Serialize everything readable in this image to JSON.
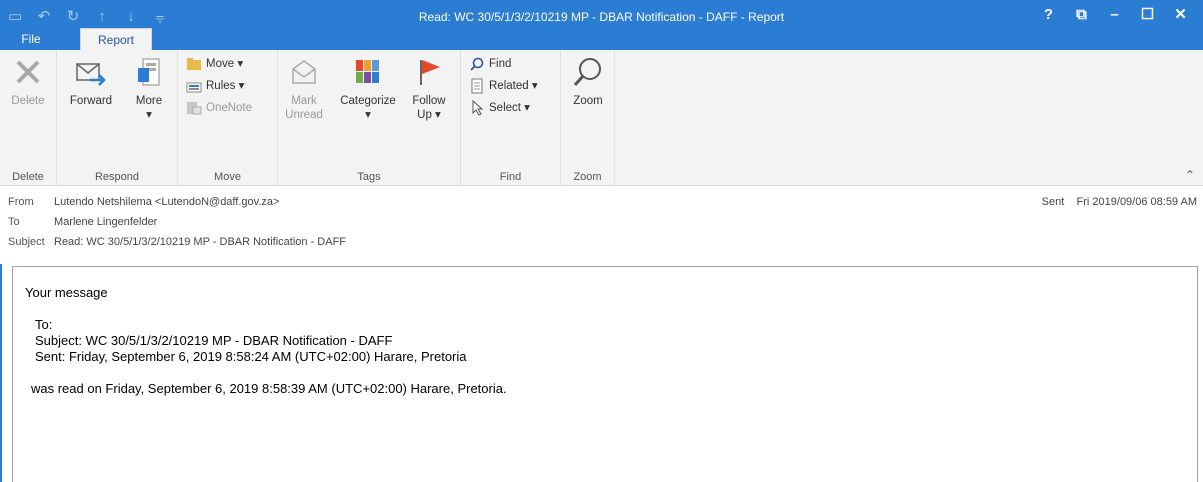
{
  "window": {
    "title": "Read: WC 30/5/1/3/2/10219 MP - DBAR Notification - DAFF - Report",
    "controls": [
      "?",
      "⧉",
      "–",
      "☐",
      "✕"
    ]
  },
  "qat": [
    "save-icon",
    "undo-icon",
    "redo-icon",
    "up-icon",
    "down-icon",
    "customize-icon"
  ],
  "tabs": [
    {
      "label": "File"
    },
    {
      "label": "Report"
    }
  ],
  "ribbon": {
    "delete": {
      "label": "Delete",
      "group": "Delete"
    },
    "respond": {
      "forward": "Forward",
      "more": "More",
      "more_arrow": "▾",
      "group": "Respond"
    },
    "move": {
      "move": "Move ▾",
      "rules": "Rules ▾",
      "onenote": "OneNote",
      "group": "Move"
    },
    "tags": {
      "mark1": "Mark",
      "mark2": "Unread",
      "categorize": "Categorize",
      "categorize_arrow": "▾",
      "follow1": "Follow",
      "follow2": "Up ▾",
      "group": "Tags"
    },
    "find": {
      "find": "Find",
      "related": "Related ▾",
      "select": "Select ▾",
      "group": "Find"
    },
    "zoom": {
      "label": "Zoom",
      "group": "Zoom"
    }
  },
  "header": {
    "from_label": "From",
    "from_value": "Lutendo Netshilema <LutendoN@daff.gov.za>",
    "to_label": "To",
    "to_value": "Marlene Lingenfelder",
    "subject_label": "Subject",
    "subject_value": "Read: WC 30/5/1/3/2/10219 MP - DBAR Notification - DAFF",
    "sent_label": "Sent",
    "sent_value": "Fri 2019/09/06 08:59 AM"
  },
  "message": {
    "line1": "Your message",
    "to": "To:",
    "subject": "Subject: WC 30/5/1/3/2/10219 MP - DBAR Notification - DAFF",
    "sent": "Sent: Friday, September 6, 2019 8:58:24 AM (UTC+02:00) Harare, Pretoria",
    "read": "was read on Friday, September 6, 2019 8:58:39 AM (UTC+02:00) Harare, Pretoria."
  },
  "colors": {
    "accent": "#2b7cd3",
    "ribbon_bg": "#f3f3f3",
    "flag": "#e8472a"
  }
}
